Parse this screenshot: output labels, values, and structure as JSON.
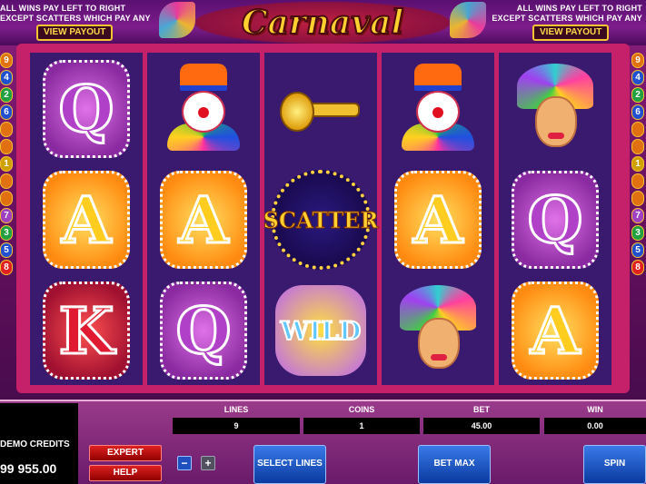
{
  "header": {
    "pay_left_line1": "ALL WINS PAY LEFT TO RIGHT",
    "pay_left_line2": "EXCEPT SCATTERS WHICH PAY ANY",
    "pay_right_line1": "ALL WINS PAY LEFT TO RIGHT",
    "pay_right_line2": "EXCEPT SCATTERS WHICH PAY ANY",
    "view_payout_label": "VIEW PAYOUT",
    "logo": "Carnaval"
  },
  "side_lines": {
    "left": [
      "9",
      "4",
      "2",
      "6",
      "",
      "",
      "1",
      "",
      "",
      "7",
      "3",
      "5",
      "8"
    ],
    "right": [
      "9",
      "4",
      "2",
      "6",
      "",
      "",
      "1",
      "",
      "",
      "7",
      "3",
      "5",
      "8"
    ]
  },
  "reels": [
    [
      "Q",
      "A",
      "K"
    ],
    [
      "clown",
      "A",
      "Q"
    ],
    [
      "trumpet",
      "scatter",
      "wild"
    ],
    [
      "clown",
      "A",
      "dancer"
    ],
    [
      "dancer",
      "Q",
      "A"
    ]
  ],
  "symbol_text": {
    "scatter": "SCATTER",
    "wild": "WILD"
  },
  "panel": {
    "credits_label": "DEMO CREDITS",
    "credits_value": "99 955.00",
    "lines_label": "LINES",
    "lines_value": "9",
    "coins_label": "COINS",
    "coins_value": "1",
    "bet_label": "BET",
    "bet_value": "45.00",
    "win_label": "WIN",
    "win_value": "0.00",
    "expert_label": "EXPERT",
    "help_label": "HELP",
    "minus_label": "−",
    "plus_label": "+",
    "select_lines_label": "SELECT LINES",
    "bet_max_label": "BET MAX",
    "spin_label": "SPIN"
  },
  "colors": {
    "line_colors": [
      "#e07010",
      "#2050d0",
      "#20a040",
      "#2050d0",
      "#e07010",
      "#e07010",
      "#d0a000",
      "#e07010",
      "#e07010",
      "#a040c0",
      "#20a040",
      "#2050d0",
      "#e02020"
    ]
  }
}
